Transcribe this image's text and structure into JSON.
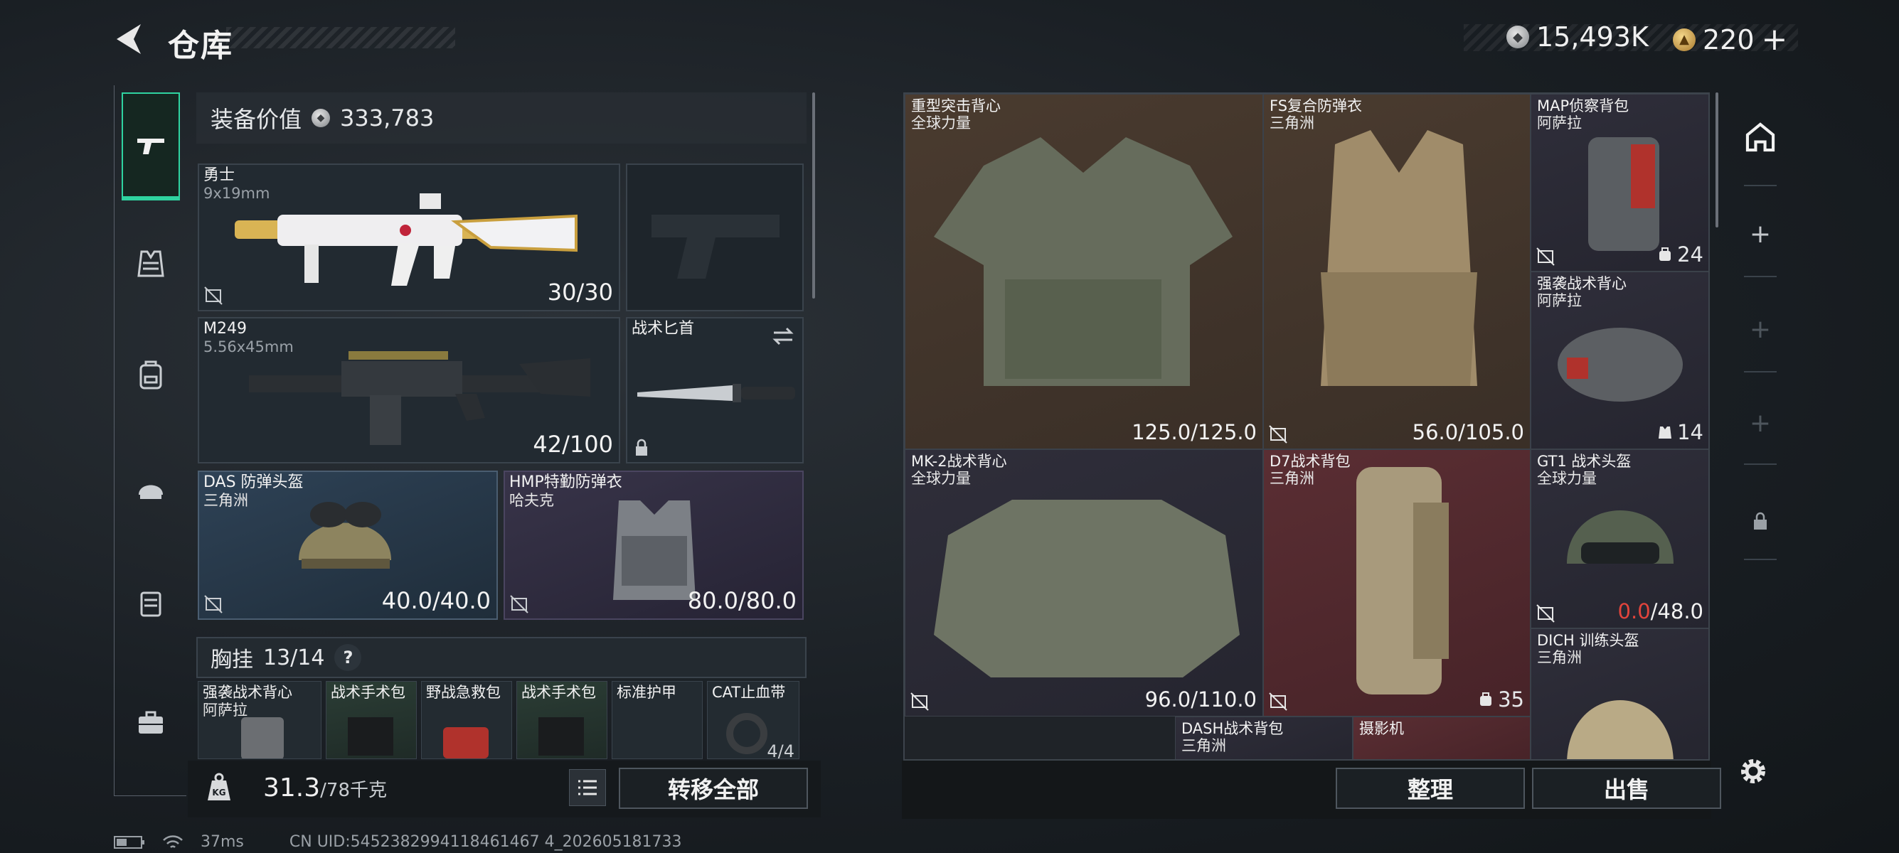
{
  "header": {
    "title": "仓库",
    "currency_silver": "15,493K",
    "currency_gold": "220",
    "gold_plus": "+"
  },
  "tabs": [
    "gun-icon",
    "vest-icon",
    "backpack-icon",
    "helmet-icon",
    "chest-rig-icon",
    "briefcase-icon"
  ],
  "loadout": {
    "value_label": "装备价值",
    "value": "333,783",
    "primary": {
      "name": "勇士",
      "caliber": "9x19mm",
      "ammo": "30/30"
    },
    "pistol": {
      "name": "",
      "empty": true
    },
    "secondary": {
      "name": "M249",
      "caliber": "5.56x45mm",
      "ammo": "42/100"
    },
    "melee": {
      "name": "战术匕首"
    },
    "helmet": {
      "name": "DAS 防弹头盔",
      "origin": "三角洲",
      "durability": "40.0/40.0"
    },
    "armor": {
      "name": "HMP特勤防弹衣",
      "origin": "哈夫克",
      "durability": "80.0/80.0"
    },
    "rig_label": "胸挂",
    "rig_capacity": "13/14",
    "rig_help": "?",
    "rig_items": [
      {
        "name": "强袭战术背心",
        "origin": "阿萨拉"
      },
      {
        "name": "战术手术包"
      },
      {
        "name": "野战急救包"
      },
      {
        "name": "战术手术包"
      },
      {
        "name": "标准护甲"
      },
      {
        "name": "CAT止血带",
        "count": "4/4"
      }
    ]
  },
  "bottom_left": {
    "weight": "31.3",
    "weight_max": "/78千克",
    "transfer_all": "转移全部"
  },
  "storage": {
    "items": [
      {
        "name": "重型突击背心",
        "origin": "全球力量",
        "durability": "125.0/125.0"
      },
      {
        "name": "FS复合防弹衣",
        "origin": "三角洲",
        "durability": "56.0/105.0"
      },
      {
        "name": "MAP侦察背包",
        "origin": "阿萨拉",
        "count": "24"
      },
      {
        "name": "强袭战术背心",
        "origin": "阿萨拉",
        "count": "14"
      },
      {
        "name": "MK-2战术背心",
        "origin": "全球力量",
        "durability": "96.0/110.0"
      },
      {
        "name": "D7战术背包",
        "origin": "三角洲",
        "count": "35"
      },
      {
        "name": "GT1 战术头盔",
        "origin": "全球力量",
        "durability_current": "0.0",
        "durability_max": "/48.0"
      },
      {
        "name": "DICH 训练头盔",
        "origin": "三角洲"
      },
      {
        "name": "DASH战术背包",
        "origin": "三角洲"
      },
      {
        "name": "摄影机"
      }
    ],
    "sort_label": "整理",
    "sell_label": "出售"
  },
  "status": {
    "ping": "37ms",
    "uid": "CN UID:5452382994118461467 4_202605181733"
  },
  "colors": {
    "accent": "#2fd3a0",
    "warning": "#e2443c",
    "brown_cell": "#4a3b2f",
    "red_cell": "#5a2e33",
    "blue_slot": "#2e4256",
    "purple_slot": "#383449"
  }
}
